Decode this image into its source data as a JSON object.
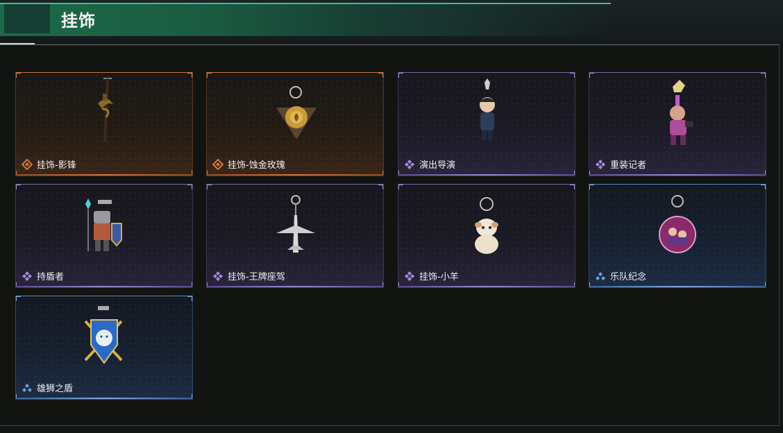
{
  "header": {
    "title": "挂饰"
  },
  "items": [
    {
      "name": "挂饰-影锋",
      "rarity": "orange",
      "art": "blade-charm"
    },
    {
      "name": "挂饰-蚀金玫瑰",
      "rarity": "orange",
      "art": "rose-charm"
    },
    {
      "name": "演出导演",
      "rarity": "purple",
      "art": "director-figure-charm"
    },
    {
      "name": "重装记者",
      "rarity": "purple",
      "art": "reporter-figure-charm"
    },
    {
      "name": "持盾者",
      "rarity": "purple",
      "art": "shield-bearer-charm"
    },
    {
      "name": "挂饰-王牌座驾",
      "rarity": "purple",
      "art": "jet-plane-charm"
    },
    {
      "name": "挂饰-小羊",
      "rarity": "purple",
      "art": "lamb-charm"
    },
    {
      "name": "乐队纪念",
      "rarity": "blue",
      "art": "band-badge-charm"
    },
    {
      "name": "雄狮之盾",
      "rarity": "blue",
      "art": "lion-shield-charm"
    }
  ],
  "colors": {
    "orange": "#c9743a",
    "purple": "#9a84d2",
    "blue": "#7ea6dc",
    "accent": "#3fc08a"
  }
}
